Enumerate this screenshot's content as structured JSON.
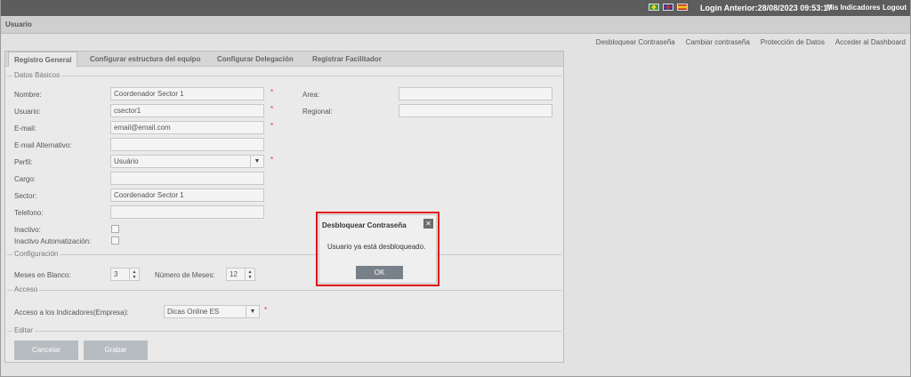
{
  "topbar": {
    "login": "Login Anterior:28/08/2023 09:53:17",
    "indicators": "Mis Indicadores",
    "logout": "Logout"
  },
  "page_title": "Usuario",
  "actions": [
    "Desbloquear Contraseña",
    "Cambiar contraseña",
    "Protección de Datos",
    "Acceder al Dashboard"
  ],
  "tabs": [
    "Registro General",
    "Configurar estructura del equipo",
    "Configurar Delegación",
    "Registrar Facilitador"
  ],
  "sections": {
    "basic": "Datos Básicos",
    "config": "Configuración",
    "access": "Acceso",
    "edit": "Editar"
  },
  "fields": {
    "nombre": {
      "label": "Nombre:",
      "value": "Coordenador Sector 1"
    },
    "usuario": {
      "label": "Usuario:",
      "value": "csector1"
    },
    "email": {
      "label": "E-mail:",
      "value": "email@email.com"
    },
    "email_alt": {
      "label": "E-mail Alternativo:",
      "value": ""
    },
    "perfil": {
      "label": "Perfil:",
      "value": "Usuário"
    },
    "cargo": {
      "label": "Cargo:",
      "value": ""
    },
    "sector": {
      "label": "Sector:",
      "value": "Coordenador Sector 1"
    },
    "telefono": {
      "label": "Telefono:",
      "value": ""
    },
    "inactivo": {
      "label": "Inactivo:"
    },
    "inactivo_auto": {
      "label": "Inactivo Automatización:"
    },
    "area": {
      "label": "Area:",
      "value": ""
    },
    "regional": {
      "label": "Regional:",
      "value": ""
    },
    "meses_blanco": {
      "label": "Meses en Blanco:",
      "value": "3"
    },
    "num_meses": {
      "label": "Número de Meses:",
      "value": "12"
    },
    "acceso": {
      "label": "Acceso a los Indicadores(Empresa):",
      "value": "Dicas Online ES"
    }
  },
  "required_mark": "*",
  "buttons": {
    "cancel": "Cancelar",
    "save": "Grabar"
  },
  "dialog": {
    "title": "Desbloquear Contraseña",
    "close": "✕",
    "message": "Usuario ya está desbloqueado.",
    "ok": "OK"
  },
  "colors": {
    "highlight": "#e0101a",
    "required": "#e03030"
  }
}
